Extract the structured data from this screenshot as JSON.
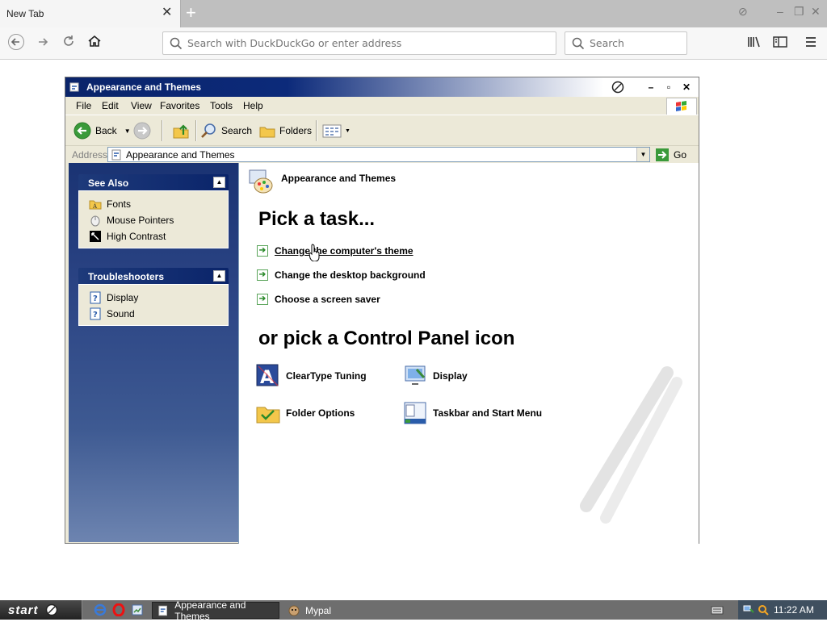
{
  "browser": {
    "tab_title": "New Tab",
    "address_placeholder": "Search with DuckDuckGo or enter address",
    "search_placeholder": "Search"
  },
  "window": {
    "title": "Appearance and Themes",
    "menu": [
      "File",
      "Edit",
      "View",
      "Favorites",
      "Tools",
      "Help"
    ],
    "toolbar": {
      "back_label": "Back",
      "search_label": "Search",
      "folders_label": "Folders"
    },
    "address": {
      "label": "Address",
      "value": "Appearance and Themes",
      "go_label": "Go"
    }
  },
  "sidebar": {
    "see_also": {
      "title": "See Also",
      "items": [
        {
          "label": "Fonts",
          "icon": "folder-fonts-icon"
        },
        {
          "label": "Mouse Pointers",
          "icon": "mouse-icon"
        },
        {
          "label": "High Contrast",
          "icon": "contrast-icon"
        }
      ]
    },
    "troubleshooters": {
      "title": "Troubleshooters",
      "items": [
        {
          "label": "Display",
          "icon": "help-icon"
        },
        {
          "label": "Sound",
          "icon": "help-icon"
        }
      ]
    }
  },
  "content": {
    "header_title": "Appearance and Themes",
    "pick_task_heading": "Pick a task...",
    "tasks": [
      {
        "label": "Change the computer's theme",
        "hovered": true
      },
      {
        "label": "Change the desktop background",
        "hovered": false
      },
      {
        "label": "Choose a screen saver",
        "hovered": false
      }
    ],
    "pick_icon_heading": "or pick a Control Panel icon",
    "icons": [
      {
        "label": "ClearType Tuning",
        "icon": "cleartype-icon"
      },
      {
        "label": "Display",
        "icon": "display-icon"
      },
      {
        "label": "Folder Options",
        "icon": "folder-options-icon"
      },
      {
        "label": "Taskbar and Start Menu",
        "icon": "taskbar-icon"
      }
    ]
  },
  "taskbar": {
    "start_label": "start",
    "tasks": [
      {
        "label": "Appearance and Themes",
        "active": true
      },
      {
        "label": "Mypal",
        "active": false
      }
    ],
    "clock": "11:22 AM"
  },
  "colors": {
    "title_blue": "#0a246a",
    "pane_top": "#1a3373",
    "xp_gray": "#ece9d8",
    "task_arrow": "#2d8b2d"
  }
}
